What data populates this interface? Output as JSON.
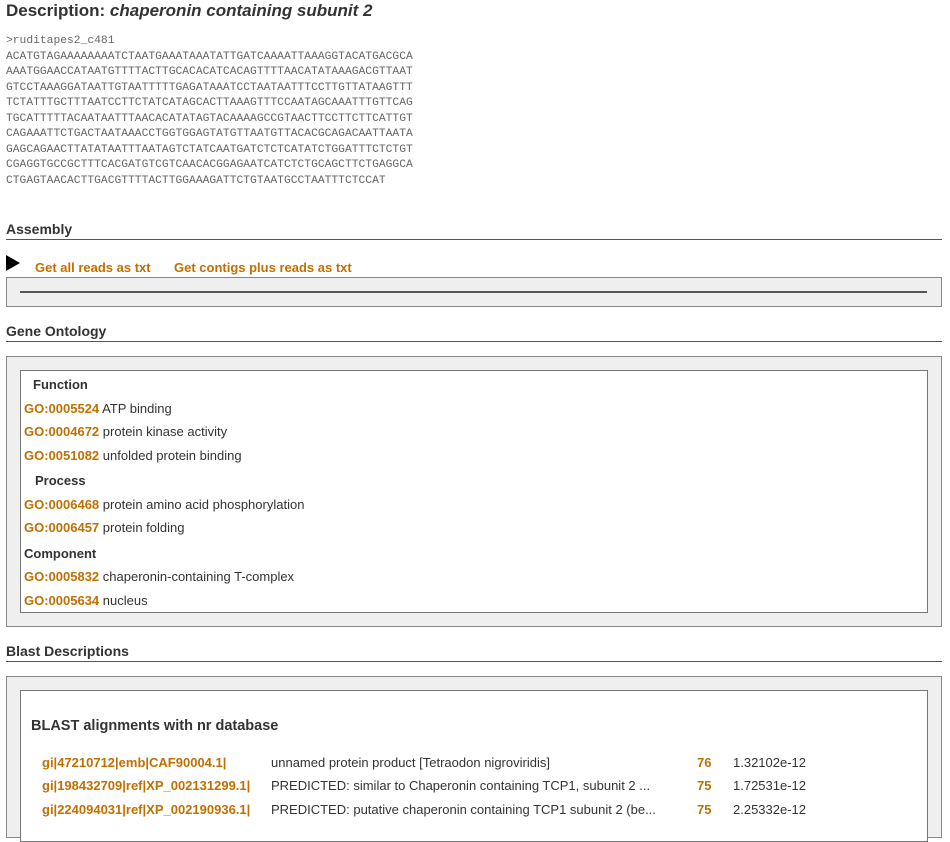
{
  "description": {
    "label": "Description:",
    "name": "chaperonin containing subunit 2"
  },
  "sequence": {
    "header": ">ruditapes2_c481",
    "lines": [
      "ACATGTAGAAAAAAAATCTAATGAAATAAATATTGATCAAAATTAAAGGTACATGACGCA",
      "AAATGGAACCATAATGTTTTACTTGCACACATCACAGTTTTAACATATAAAGACGTTAAT",
      "GTCCTAAAGGATAATTGTAATTTTTGAGATAAATCCTAATAATTTCCTTGTTATAAGTTT",
      "TCTATTTGCTTTAATCCTTCTATCATAGCACTTAAAGTTTCCAATAGCAAATTTGTTCAG",
      "TGCATTTTTACAATAATTTAACACATATAGTACAAAAGCCGTAACTTCCTTCTTCATTGT",
      "CAGAAATTCTGACTAATAAACCTGGTGGAGTATGTTAATGTTACACGCAGACAATTAATA",
      "GAGCAGAACTTATATAATTTAATAGTCTATCAATGATCTCTCATATCTGGATTTCTCTGT",
      "CGAGGTGCCGCTTTCACGATGTCGTCAACACGGAGAATCATCTCTGCAGCTTCTGAGGCA",
      "CTGAGTAACACTTGACGTTTTACTTGGAAAGATTCTGTAATGCCTAATTTCTCCAT"
    ]
  },
  "assembly": {
    "title": "Assembly",
    "links": [
      "Get all reads as txt",
      "Get contigs plus reads as txt"
    ]
  },
  "gene_ontology": {
    "title": "Gene Ontology",
    "categories": [
      {
        "name": "Function",
        "terms": [
          {
            "id": "GO:0005524",
            "label": "ATP binding"
          },
          {
            "id": "GO:0004672",
            "label": "protein kinase activity"
          },
          {
            "id": "GO:0051082",
            "label": "unfolded protein binding"
          }
        ]
      },
      {
        "name": "Process",
        "terms": [
          {
            "id": "GO:0006468",
            "label": "protein amino acid phosphorylation"
          },
          {
            "id": "GO:0006457",
            "label": "protein folding"
          }
        ]
      },
      {
        "name": "Component",
        "terms": [
          {
            "id": "GO:0005832",
            "label": "chaperonin-containing T-complex"
          },
          {
            "id": "GO:0005634",
            "label": "nucleus"
          }
        ]
      }
    ]
  },
  "blast": {
    "title": "Blast Descriptions",
    "subtitle": "BLAST alignments with nr database",
    "rows": [
      {
        "id": "gi|47210712|emb|CAF90004.1|",
        "desc": "unnamed protein product [Tetraodon nigroviridis]",
        "score": "76",
        "evalue": "1.32102e-12"
      },
      {
        "id": "gi|198432709|ref|XP_002131299.1|",
        "desc": "PREDICTED: similar to Chaperonin containing TCP1, subunit 2 ...",
        "score": "75",
        "evalue": "1.72531e-12"
      },
      {
        "id": "gi|224094031|ref|XP_002190936.1|",
        "desc": "PREDICTED: putative chaperonin containing TCP1 subunit 2 (be...",
        "score": "75",
        "evalue": "2.25332e-12"
      }
    ]
  }
}
